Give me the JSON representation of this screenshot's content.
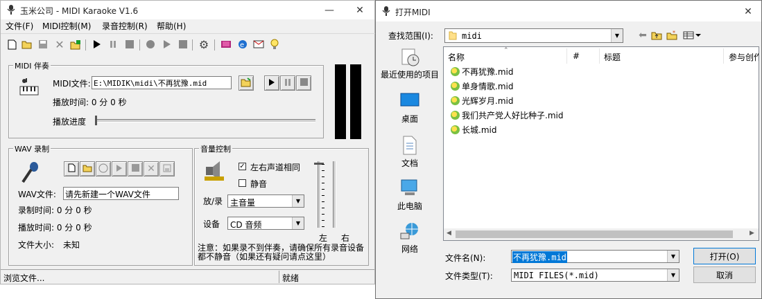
{
  "karaoke": {
    "title": "玉米公司 - MIDI Karaoke V1.6",
    "menu": [
      "文件(F)",
      "MIDI控制(M)",
      "录音控制(R)",
      "帮助(H)"
    ],
    "midi_group": {
      "label": "MIDI 伴奏",
      "file_label": "MIDI文件:",
      "file_value": "E:\\MIDIK\\midi\\不再犹豫.mid",
      "play_time": "播放时间: 0  分 0  秒",
      "progress_label": "播放进度"
    },
    "wav_group": {
      "label": "WAV 录制",
      "file_label": "WAV文件:",
      "file_value": "请先新建一个WAV文件",
      "rec_time": "录制时间:  0  分 0  秒",
      "play_time": "播放时间:  0  分 0  秒",
      "size_label": "文件大小:",
      "size_value": "未知"
    },
    "volume_group": {
      "label": "音量控制",
      "lr_same": "左右声道相同",
      "lr_same_checked": true,
      "mute": "静音",
      "mute_checked": false,
      "play_rec_label": "放/录",
      "play_rec_value": "主音量",
      "device_label": "设备",
      "device_value": "CD 音频",
      "left": "左",
      "right": "右",
      "note": "注意：如果录不到伴奏，请确保所有录音设备都不静音（如果还有疑问请点这里）"
    },
    "status_left": "浏览文件...",
    "status_right": "就绪"
  },
  "dialog": {
    "title": "打开MIDI",
    "lookin_label": "查找范围(I):",
    "lookin_value": "midi",
    "sidebar": [
      "最近使用的项目",
      "桌面",
      "文档",
      "此电脑",
      "网络"
    ],
    "columns": [
      "名称",
      "#",
      "标题",
      "参与创作"
    ],
    "files": [
      "不再犹豫.mid",
      "单身情歌.mid",
      "光辉岁月.mid",
      "我们共产党人好比种子.mid",
      "长城.mid"
    ],
    "filename_label": "文件名(N):",
    "filename_value": "不再犹豫.mid",
    "filetype_label": "文件类型(T):",
    "filetype_value": "MIDI FILES(*.mid)",
    "open_button": "打开(O)",
    "cancel_button": "取消"
  }
}
